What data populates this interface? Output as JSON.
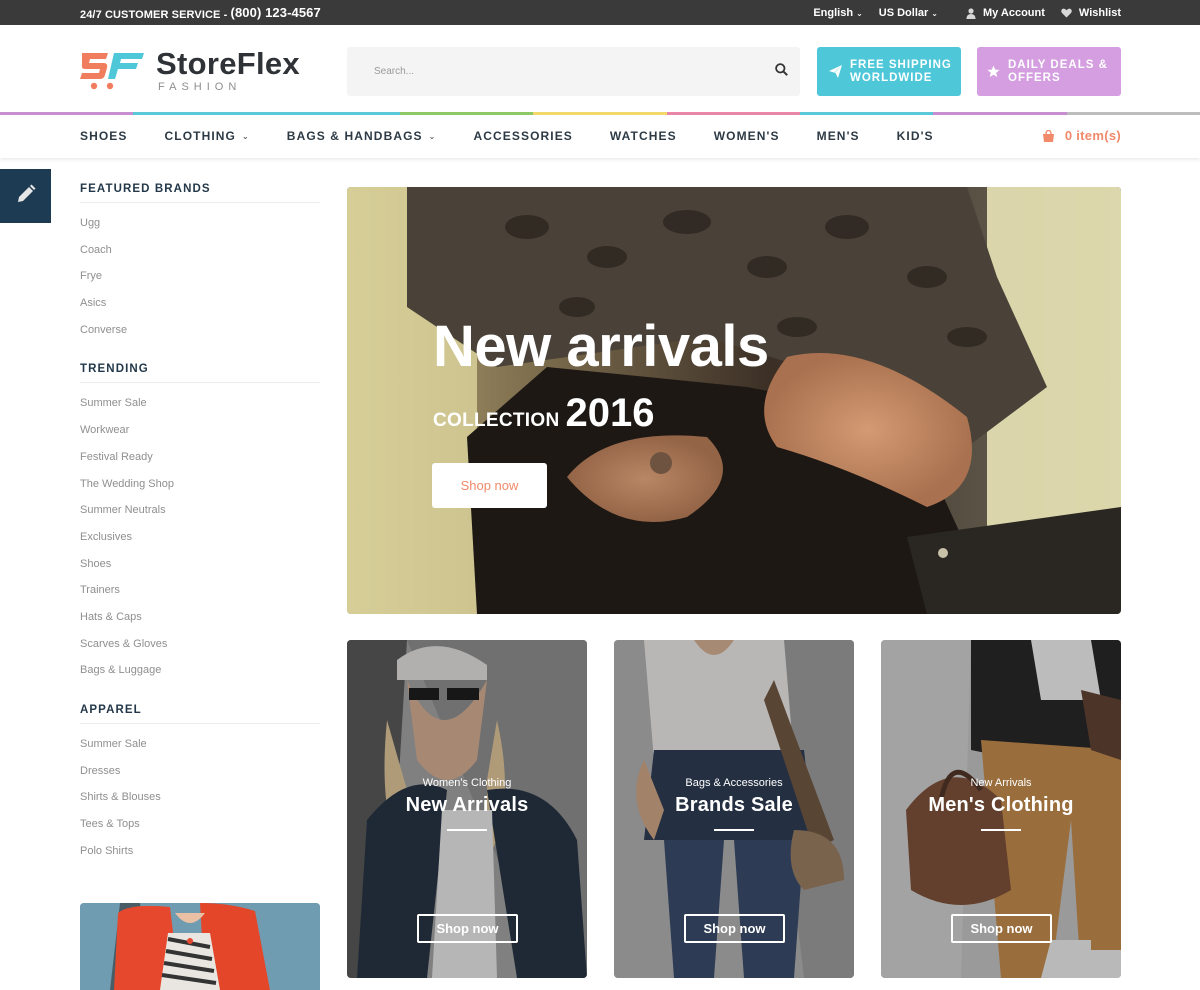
{
  "topbar": {
    "service_label": "24/7 CUSTOMER SERVICE - ",
    "phone": "(800) 123-4567",
    "language": "English",
    "currency": "US Dollar",
    "account": "My Account",
    "wishlist": "Wishlist",
    "icons": [
      "user-icon",
      "heart-icon"
    ]
  },
  "brand": {
    "mark": "SF",
    "name": "StoreFlex",
    "tagline": "FASHION"
  },
  "search": {
    "placeholder": "Search...",
    "value": ""
  },
  "promos": {
    "shipping": {
      "line1": "FREE SHIPPING",
      "line2": "WORLDWIDE",
      "color": "#4ec7d8",
      "icon": "paper-plane-icon"
    },
    "deals": {
      "line1": "DAILY DEALS &",
      "line2": "OFFERS",
      "color": "#d49ee0",
      "icon": "star-icon"
    }
  },
  "stripe_colors": [
    "#c78fd1",
    "#5bc8d8",
    "#5bc8d8",
    "#8fc867",
    "#f3d96b",
    "#e987a8",
    "#5bc8d8",
    "#c78fd1",
    "#bdbdbd"
  ],
  "nav": {
    "items": [
      {
        "label": "SHOES",
        "has_dropdown": false
      },
      {
        "label": "CLOTHING",
        "has_dropdown": true
      },
      {
        "label": "BAGS & HANDBAGS",
        "has_dropdown": true
      },
      {
        "label": "ACCESSORIES",
        "has_dropdown": false
      },
      {
        "label": "WATCHES",
        "has_dropdown": false
      },
      {
        "label": "WOMEN'S",
        "has_dropdown": false
      },
      {
        "label": "MEN'S",
        "has_dropdown": false
      },
      {
        "label": "KID'S",
        "has_dropdown": false
      }
    ],
    "cart_label": "0 item(s)",
    "cart_color": "#f08a6a"
  },
  "sidebar": {
    "featured": {
      "title": "FEATURED BRANDS",
      "items": [
        "Ugg",
        "Coach",
        "Frye",
        "Asics",
        "Converse"
      ]
    },
    "trending": {
      "title": "TRENDING",
      "items": [
        "Summer Sale",
        "Workwear",
        "Festival Ready",
        "The Wedding Shop",
        "Summer Neutrals",
        "Exclusives",
        "Shoes",
        "Trainers",
        "Hats & Caps",
        "Scarves & Gloves",
        "Bags & Luggage"
      ]
    },
    "apparel": {
      "title": "APPAREL",
      "items": [
        "Summer Sale",
        "Dresses",
        "Shirts & Blouses",
        "Tees & Tops",
        "Polo Shirts"
      ]
    }
  },
  "hero": {
    "title": "New arrivals",
    "collection": "COLLECTION",
    "year": "2016",
    "button": "Shop now"
  },
  "cards": [
    {
      "small": "Women's Clothing",
      "big": "New Arrivals",
      "button": "Shop now"
    },
    {
      "small": "Bags & Accessories",
      "big": "Brands Sale",
      "button": "Shop now"
    },
    {
      "small": "New Arrivals",
      "big": "Men's Clothing",
      "button": "Shop now"
    }
  ]
}
